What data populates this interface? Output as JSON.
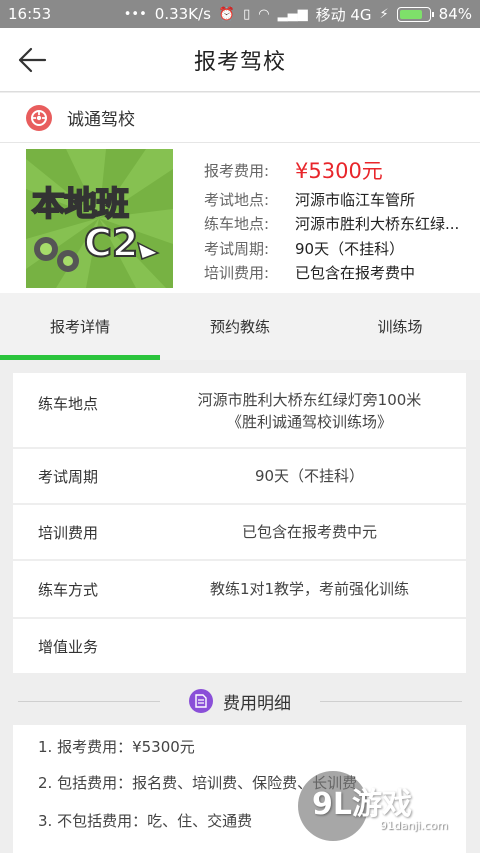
{
  "status_bar": {
    "time": "16:53",
    "speed": "0.33K/s",
    "carrier": "移动 4G",
    "battery": "84%",
    "battery_level": 0.84
  },
  "header": {
    "title": "报考驾校",
    "back_icon": "arrow-left-icon"
  },
  "school": {
    "name": "诚通驾校",
    "icon": "school-logo-icon",
    "icon_color": "#e85d5d"
  },
  "promo": {
    "line1": "本地班",
    "line2": "C2",
    "bg_color": "#77b243"
  },
  "info": {
    "fee_label": "报考费用:",
    "fee_value": "¥5300元",
    "exam_place_label": "考试地点:",
    "exam_place_value": "河源市临江车管所",
    "practice_place_label": "练车地点:",
    "practice_place_value": "河源市胜利大桥东红绿...",
    "exam_period_label": "考试周期:",
    "exam_period_value": "90天（不挂科）",
    "training_fee_label": "培训费用:",
    "training_fee_value": "已包含在报考费中",
    "price_color": "#e8262b"
  },
  "tabs": [
    {
      "label": "报考详情",
      "active": true
    },
    {
      "label": "预约教练",
      "active": false
    },
    {
      "label": "训练场",
      "active": false
    }
  ],
  "accent_color": "#2bc43c",
  "details": [
    {
      "label": "练车地点",
      "value_line1": "河源市胜利大桥东红绿灯旁100米",
      "value_line2": "《胜利诚通驾校训练场》"
    },
    {
      "label": "考试周期",
      "value_line1": "90天（不挂科）"
    },
    {
      "label": "培训费用",
      "value_line1": "已包含在报考费中元"
    },
    {
      "label": "练车方式",
      "value_line1": "教练1对1教学，考前强化训练"
    },
    {
      "label": "增值业务",
      "value_line1": ""
    }
  ],
  "fee_section": {
    "title": "费用明细",
    "icon": "document-icon",
    "icon_color": "#8a4fd8",
    "items": [
      "1. 报考费用：¥5300元",
      "2. 包括费用：报名费、培训费、保险费、长训费",
      "3. 不包括费用：吃、住、交通费"
    ]
  },
  "watermark": {
    "main": "9L游戏",
    "url": "91danji.com"
  }
}
